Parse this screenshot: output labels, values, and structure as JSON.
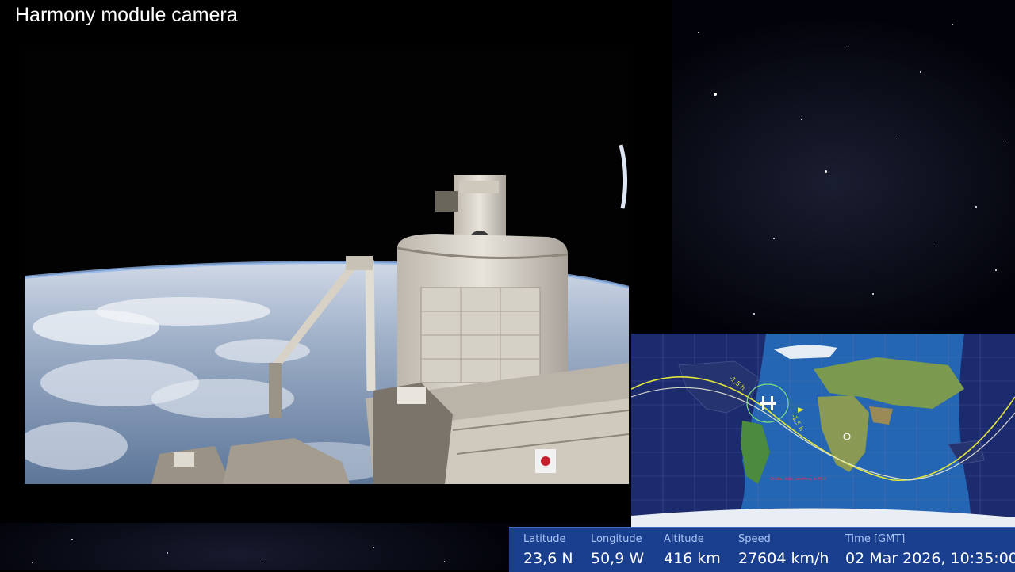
{
  "camera": {
    "title": "Harmony module camera"
  },
  "map": {
    "track_label_past": "-1,5 h",
    "track_label_future": "-1,5 h",
    "overlay_note": "Orbital data courtesy of ESA"
  },
  "telemetry": {
    "latitude_label": "Latitude",
    "latitude_value": "23,6 N",
    "longitude_label": "Longitude",
    "longitude_value": "50,9 W",
    "altitude_label": "Altitude",
    "altitude_value": "416 km",
    "speed_label": "Speed",
    "speed_value": "27604 km/h",
    "time_label": "Time [GMT]",
    "time_value": "02 Mar 2026, 10:35:00"
  },
  "colors": {
    "info_bar": "#1a3f8f",
    "info_label": "#a9c4f2",
    "orbit_track": "#e3e63a",
    "ocean": "#1c5fa8"
  }
}
